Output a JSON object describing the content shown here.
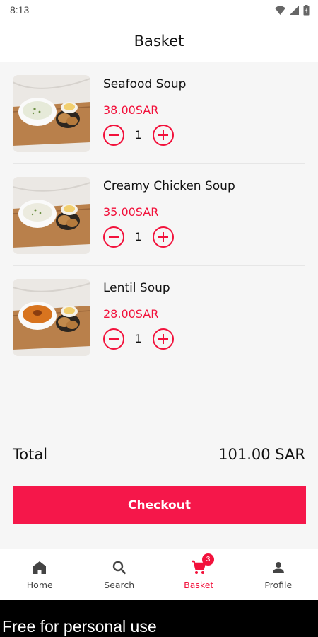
{
  "status_bar": {
    "time": "8:13",
    "icons": [
      "wifi-icon",
      "signal-icon",
      "battery-icon"
    ]
  },
  "header": {
    "title": "Basket"
  },
  "basket": {
    "items": [
      {
        "name": "Seafood Soup",
        "price": "38.00SAR",
        "quantity": "1",
        "image": "seafood-soup-image"
      },
      {
        "name": "Creamy Chicken Soup",
        "price": "35.00SAR",
        "quantity": "1",
        "image": "creamy-chicken-soup-image"
      },
      {
        "name": "Lentil Soup",
        "price": "28.00SAR",
        "quantity": "1",
        "image": "lentil-soup-image"
      }
    ],
    "total_label": "Total",
    "total_value": "101.00 SAR",
    "checkout_label": "Checkout"
  },
  "nav": {
    "items": [
      {
        "label": "Home",
        "icon": "home-icon",
        "active": false
      },
      {
        "label": "Search",
        "icon": "search-icon",
        "active": false
      },
      {
        "label": "Basket",
        "icon": "cart-icon",
        "active": true,
        "badge": "3"
      },
      {
        "label": "Profile",
        "icon": "person-icon",
        "active": false
      }
    ]
  },
  "watermark": {
    "text": "Free for personal use"
  },
  "colors": {
    "accent": "#f2113b",
    "checkout": "#f5174a",
    "background": "#f6f6f6",
    "watermark_bar": "#000000"
  }
}
